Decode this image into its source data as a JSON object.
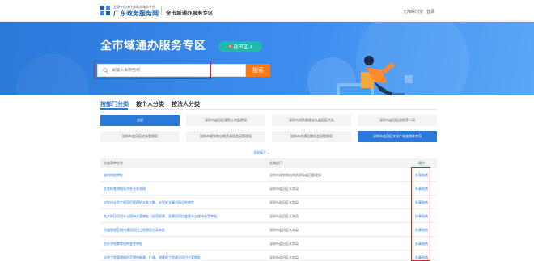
{
  "header": {
    "logo_small": "全国一体化在线政务服务平台",
    "logo_title": "广东政务服务网",
    "zone": "全市域通办服务专区",
    "accessibility": "无障碍浏览",
    "login": "登录"
  },
  "banner": {
    "title": "全市域通办服务专区",
    "district": "盐田区",
    "search_placeholder": "请输入事项名称",
    "search_button": "搜索"
  },
  "tabs": [
    "按部门分类",
    "按个人分类",
    "按法人分类"
  ],
  "departments": [
    "全部",
    "深圳市盐田区规划土地监察局",
    "深圳市消防救援支队盐田区大队",
    "深圳市盐田区退役军人局",
    "深圳市盐田区应急管理局",
    "深圳市规划和自然资源局盐田管理局",
    "深圳市交通运输局盐田管理局",
    "深圳市盐田区文化广电旅游体育局"
  ],
  "active_department": "深圳市盐田区文化广电旅游体育局",
  "expand_label": "全部展开 ⌄",
  "table": {
    "headers": [
      "实施清单名称",
      "实施部门",
      "操作"
    ],
    "rows": [
      {
        "name": "临时用地审批",
        "dept": "深圳市规划和自然资源局盐田管理局",
        "op": "办事指南"
      },
      {
        "name": "文化检查和指导对外业务办理",
        "dept": "深圳市盐田区水务局",
        "op": "办事指南"
      },
      {
        "name": "对农村水利工程项目管理的水务大额、水利安全事业情况的审定",
        "dept": "深圳市盐田区水务局",
        "op": "办事指南"
      },
      {
        "name": "生产建设项目水土保持方案审批（适用权限，含建设项目变更水土保持方案审批）",
        "dept": "深圳市盐田区水务局",
        "op": "办事指南"
      },
      {
        "name": "河道管理范围内建设项目工程建设方案审批",
        "dept": "深圳市盐田区水务局",
        "op": "办事指南"
      },
      {
        "name": "民办学校教育机构变更审批",
        "dept": "深圳市盐田区水务局",
        "op": "办事指南"
      },
      {
        "name": "水利工程管理保护范围内新建、扩建、改建的工程建设项目方案审批",
        "dept": "深圳市盐田区水务局",
        "op": "办事指南"
      }
    ]
  },
  "colors": {
    "primary": "#2a78d8",
    "accent": "#f47a1f",
    "district": "#1fbba6",
    "highlight": "#e02020"
  }
}
